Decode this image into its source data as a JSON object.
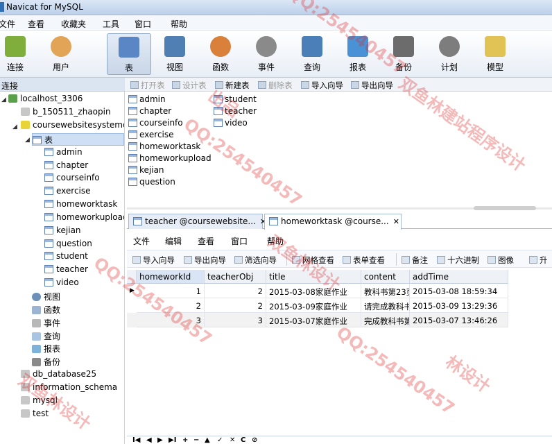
{
  "window": {
    "title": "Navicat for MySQL"
  },
  "menu": [
    "文件",
    "查看",
    "收藏夹",
    "工具",
    "窗口",
    "帮助"
  ],
  "toolbar": [
    {
      "label": "连接",
      "icon": "plug-icon",
      "color": "#7fae3c",
      "active": false
    },
    {
      "label": "用户",
      "icon": "user-icon",
      "color": "#e2a457",
      "active": false
    },
    {
      "label": "表",
      "icon": "table-icon",
      "color": "#5b86c5",
      "active": true
    },
    {
      "label": "视图",
      "icon": "view-icon",
      "color": "#4f7fb3",
      "active": false
    },
    {
      "label": "函数",
      "icon": "function-icon",
      "color": "#d9803a",
      "active": false
    },
    {
      "label": "事件",
      "icon": "clock-icon",
      "color": "#8a8a8a",
      "active": false
    },
    {
      "label": "查询",
      "icon": "query-icon",
      "color": "#4a7fb8",
      "active": false
    },
    {
      "label": "报表",
      "icon": "report-icon",
      "color": "#4a92d6",
      "active": false
    },
    {
      "label": "备份",
      "icon": "backup-icon",
      "color": "#6c6c6c",
      "active": false
    },
    {
      "label": "计划",
      "icon": "schedule-icon",
      "color": "#7d7d7d",
      "active": false
    },
    {
      "label": "模型",
      "icon": "model-icon",
      "color": "#e0c255",
      "active": false
    }
  ],
  "left_panel_header": "连接",
  "object_toolbar": [
    {
      "label": "打开表",
      "disabled": true
    },
    {
      "label": "设计表",
      "disabled": true
    },
    {
      "label": "新建表",
      "disabled": false
    },
    {
      "label": "删除表",
      "disabled": true
    },
    {
      "label": "导入向导",
      "disabled": false
    },
    {
      "label": "导出向导",
      "disabled": false
    }
  ],
  "tree": {
    "connection": "localhost_3306",
    "db_other1": "b_150511_zhaopin",
    "db_open": "coursewebsitesystemdb",
    "tables_node": "表",
    "tables": [
      "admin",
      "chapter",
      "courseinfo",
      "exercise",
      "homeworktask",
      "homeworkupload",
      "kejian",
      "question",
      "student",
      "teacher",
      "video"
    ],
    "other_nodes": [
      "视图",
      "函数",
      "事件",
      "查询",
      "报表",
      "备份"
    ],
    "dbs_after": [
      "db_database25",
      "information_schema",
      "mysql",
      "test"
    ]
  },
  "object_list": [
    "admin",
    "chapter",
    "courseinfo",
    "exercise",
    "homeworktask",
    "homeworkupload",
    "kejian",
    "question",
    "student",
    "teacher",
    "video"
  ],
  "tabs": [
    {
      "label": "teacher @coursewebsite...",
      "active": false
    },
    {
      "label": "homeworktask @course...",
      "active": true
    }
  ],
  "inner_menu": [
    "文件",
    "编辑",
    "查看",
    "窗口",
    "帮助"
  ],
  "inner_toolbar": [
    "导入向导",
    "导出向导",
    "筛选向导",
    "网格查看",
    "表单查看",
    "备注",
    "十六进制",
    "图像",
    "升"
  ],
  "grid": {
    "columns": [
      "homeworkId",
      "teacherObj",
      "title",
      "content",
      "addTime"
    ],
    "rows": [
      [
        "1",
        "2",
        "2015-03-08家庭作业",
        "教科书第23页",
        "2015-03-08 18:59:34"
      ],
      [
        "2",
        "2",
        "2015-03-09家庭作业",
        "请完成教科书",
        "2015-03-09 13:29:36"
      ],
      [
        "3",
        "3",
        "2015-03-07家庭作业",
        "完成教科书第",
        "2015-03-07 13:46:26"
      ]
    ]
  },
  "nav_controls": [
    "I◀",
    "◀",
    "▶",
    "▶I",
    "+",
    "−",
    "▲",
    "✓",
    "✕",
    "C",
    "⊘"
  ],
  "watermark": [
    "林设计",
    "QQ:254540457",
    "双鱼林设计",
    "出品",
    "双鱼林建站程序设计"
  ]
}
